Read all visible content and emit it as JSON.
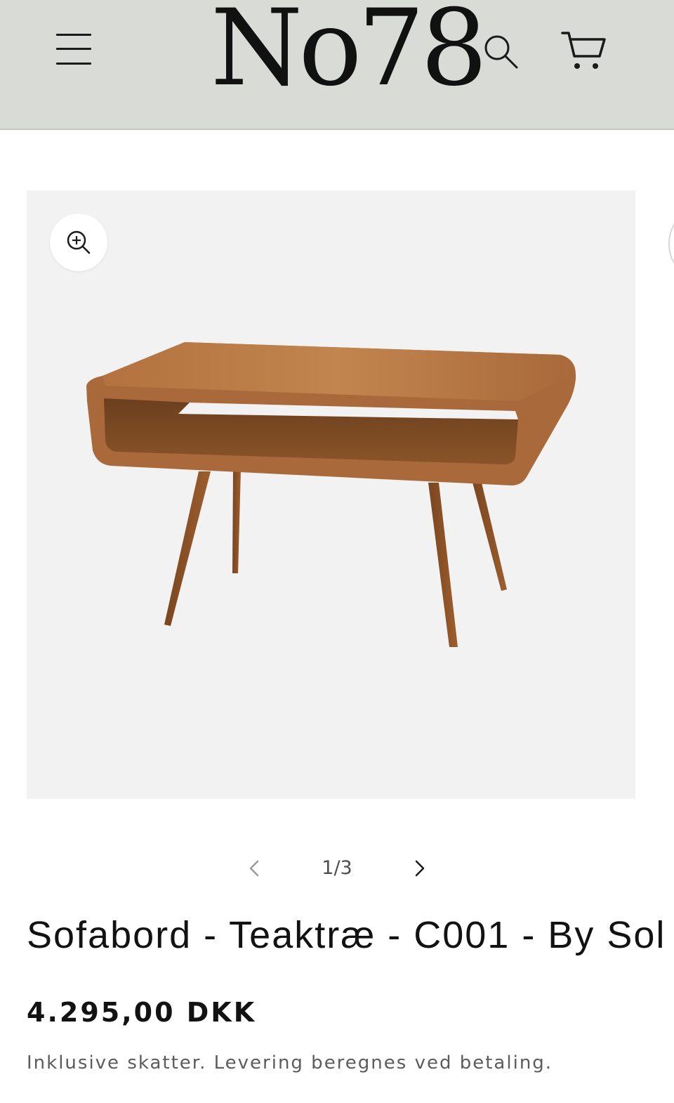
{
  "header": {
    "logo_text": "No78",
    "menu_icon": "hamburger-menu-icon",
    "search_icon": "search-icon",
    "cart_icon": "cart-icon",
    "background": "#d9dcd6"
  },
  "gallery": {
    "zoom_icon": "zoom-in-icon",
    "image_subject": "teak coffee table",
    "current": 1,
    "total": 3,
    "counter_text": "1/3",
    "prev_icon": "chevron-left-icon",
    "next_icon": "chevron-right-icon"
  },
  "product": {
    "title": "Sofabord - Teaktræ - C001 - By Sol",
    "price": "4.295,00 DKK",
    "tax_note": "Inklusive skatter. Levering beregnes ved betaling."
  }
}
